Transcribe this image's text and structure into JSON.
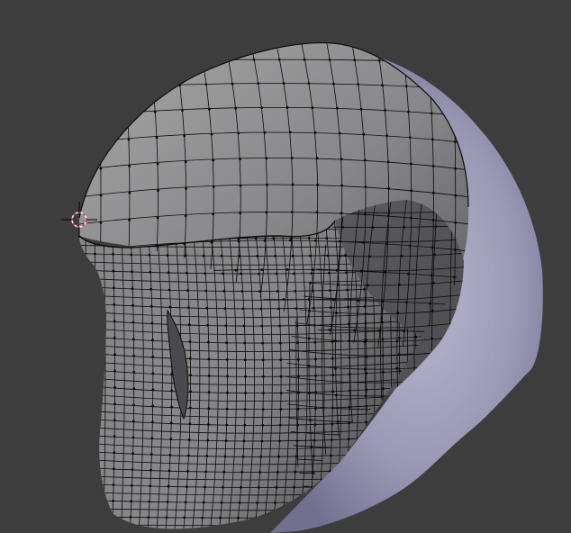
{
  "viewport": {
    "background_color": "#3d3d3d",
    "grid_visible": false,
    "header_visible": false,
    "text_overlays_visible": false
  },
  "scene": {
    "object": "head-sculpt-mesh",
    "mode": "edit-mode-wireframe-overlay",
    "cursor_3d_visible": true,
    "selection": "none"
  },
  "colors": {
    "mesh_light": "#a5a5a6",
    "mesh_mid": "#878789",
    "mesh_dark": "#5d5d60",
    "mesh_shadow": "#4a4a4e",
    "sculpt_lavender": "#9a98b4",
    "sculpt_lavender_dark": "#727090",
    "sculpt_lavender_light": "#b8b6d0",
    "wire": "#0a0a0a",
    "cursor_ring_red": "#d8403a",
    "cursor_ring_white": "#f2f2f2",
    "cursor_cross": "#000000"
  },
  "icons": {
    "cursor": "3d-cursor-icon"
  }
}
